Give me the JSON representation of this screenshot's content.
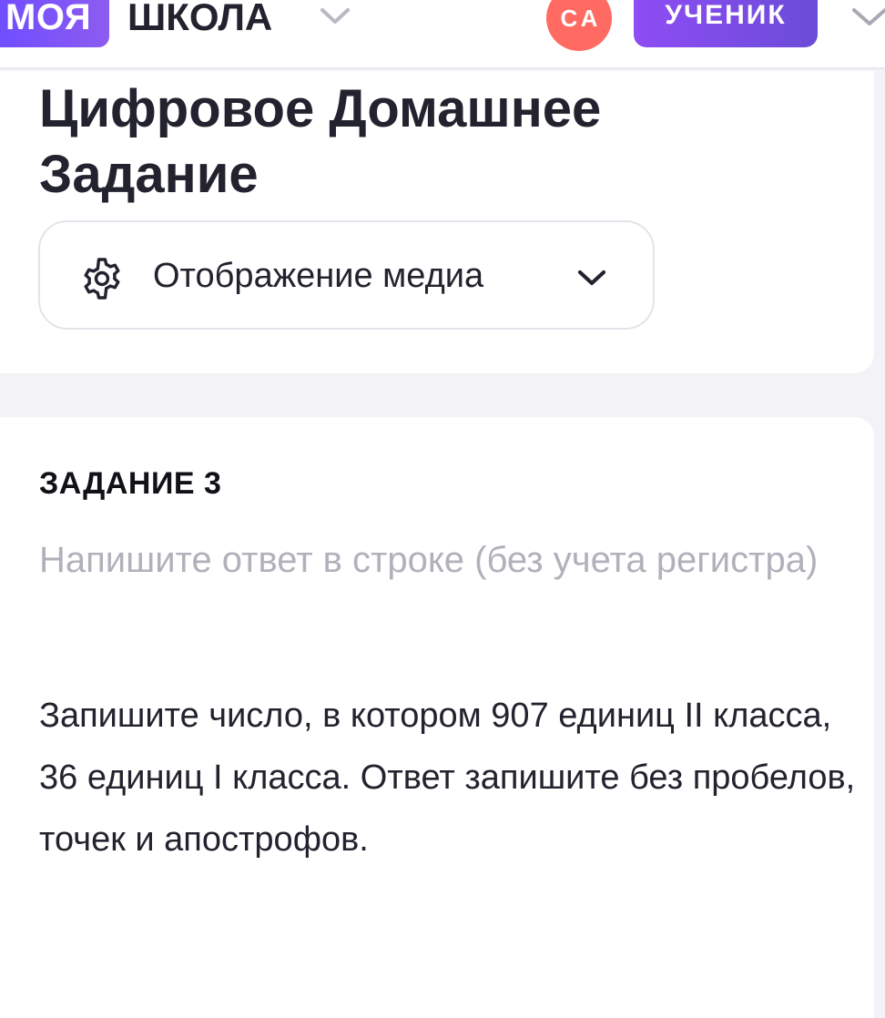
{
  "header": {
    "logo_badge": "МОЯ",
    "logo_word": "ШКОЛА",
    "avatar_initials": "СА",
    "role": "УЧЕНИК"
  },
  "page": {
    "title": "Цифровое Домашнее Задание"
  },
  "media_select": {
    "label": "Отображение медиа"
  },
  "task": {
    "number_label": "ЗАДАНИЕ 3",
    "hint": "Напишите ответ в строке (без учета регистра)",
    "text": "Запишите число, в котором 907 единиц II класса, 36 единиц I класса. Ответ запишите без пробелов, точек и апострофов."
  },
  "colors": {
    "brand_purple": "#6f4dff",
    "avatar_red": "#ff6b63",
    "role_purple": "#8e4cf4",
    "background": "#f3f3f7"
  },
  "icons": {
    "logo_dropdown": "chevron-down-icon",
    "role_dropdown": "chevron-down-icon",
    "media_settings": "gear-icon",
    "media_dropdown": "chevron-down-icon"
  }
}
